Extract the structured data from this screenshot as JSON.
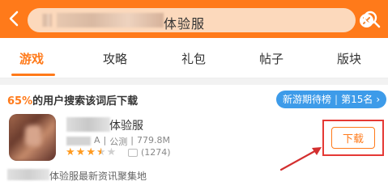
{
  "search": {
    "query_visible": "体验服",
    "back_icon": "chevron-left-icon",
    "clear_icon": "close-circle-icon",
    "search_icon": "search-icon"
  },
  "tabs": [
    {
      "label": "游戏",
      "active": true
    },
    {
      "label": "攻略",
      "active": false
    },
    {
      "label": "礼包",
      "active": false
    },
    {
      "label": "帖子",
      "active": false
    },
    {
      "label": "版块",
      "active": false
    }
  ],
  "headline": {
    "percent": "65%",
    "text": "的用户搜索该词后下载"
  },
  "rank_badge": {
    "list": "新游期待榜",
    "separator": "|",
    "rank": "第15名",
    "chevron": "›"
  },
  "game": {
    "title_visible": "体验服",
    "category_visible": "A",
    "separator": "|",
    "status": "公测",
    "size": "779.8M",
    "rating": 3.5,
    "review_count": "(1274)",
    "download_label": "下载"
  },
  "footer": {
    "text_visible": "体验服最新资讯聚集地"
  },
  "colors": {
    "accent": "#ff7a1a",
    "badge_blue": "#3d9be9",
    "highlight_red": "#e53935"
  }
}
